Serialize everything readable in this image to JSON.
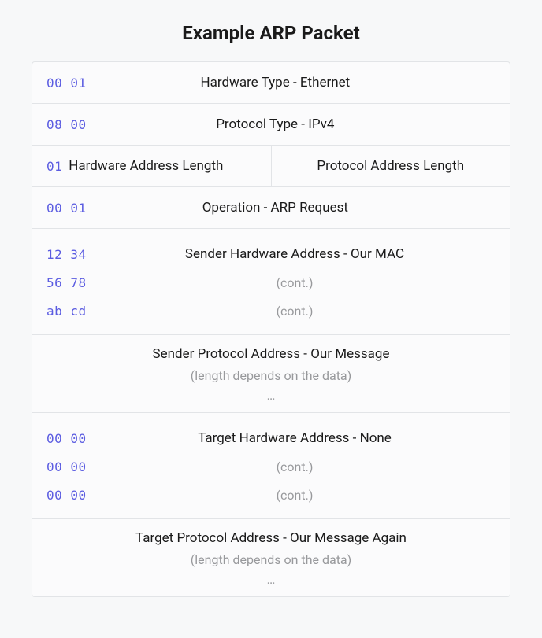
{
  "title": "Example ARP Packet",
  "rows": {
    "hardware_type": {
      "hex": "00 01",
      "label": "Hardware Type - Ethernet"
    },
    "protocol_type": {
      "hex": "08 00",
      "label": "Protocol Type - IPv4"
    },
    "hw_addr_len": {
      "hex": "01",
      "label": "Hardware Address Length"
    },
    "proto_addr_len": {
      "label": "Protocol Address Length"
    },
    "operation": {
      "hex": "00 01",
      "label": "Operation - ARP Request"
    },
    "sender_hw": {
      "label": "Sender Hardware Address - Our MAC",
      "hex1": "12 34",
      "hex2": "56 78",
      "hex3": "ab cd",
      "cont": "(cont.)"
    },
    "sender_proto": {
      "label": "Sender Protocol Address - Our Message",
      "note": "(length depends on the data)",
      "dots": "…"
    },
    "target_hw": {
      "label": "Target Hardware Address - None",
      "hex1": "00 00",
      "hex2": "00 00",
      "hex3": "00 00",
      "cont": "(cont.)"
    },
    "target_proto": {
      "label": "Target Protocol Address - Our Message Again",
      "note": "(length depends on the data)",
      "dots": "…"
    }
  }
}
